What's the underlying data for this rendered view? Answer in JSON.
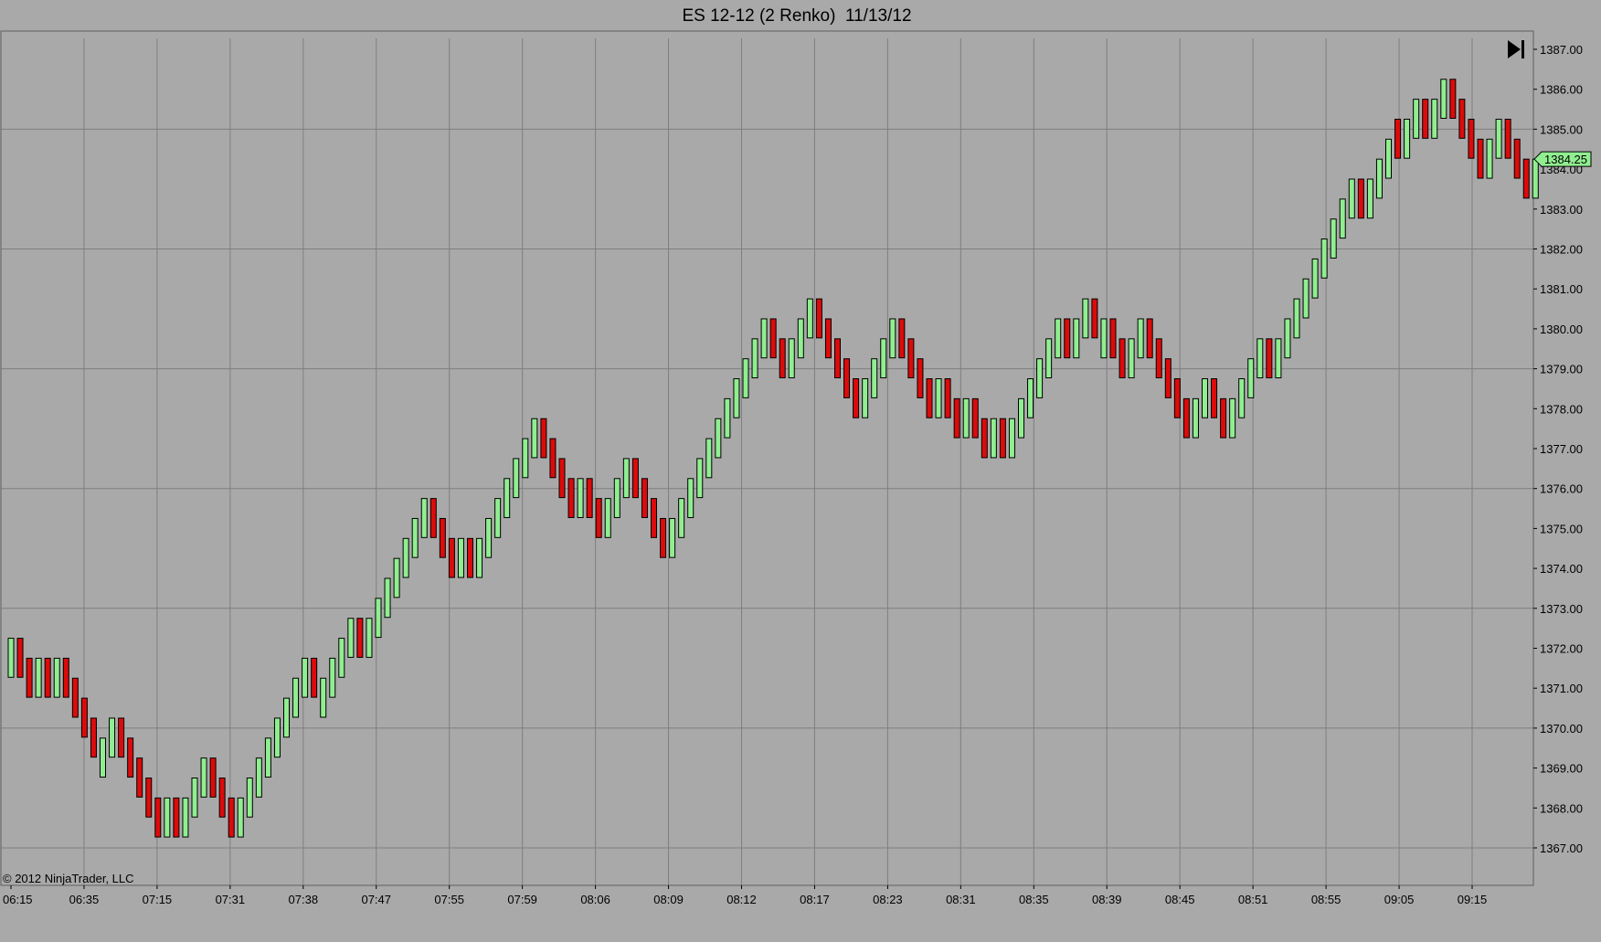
{
  "window": {
    "title": "ES 12-12 (2 Renko)  11/13/12",
    "copyright": "© 2012 NinjaTrader, LLC",
    "scroll_to_end_icon": "skip-to-end-icon"
  },
  "colors": {
    "background": "#a9a9a9",
    "grid": "#7f7f7f",
    "up_brick": "#90ee90",
    "down_brick": "#dc0b0b",
    "brick_outline": "#000000",
    "current_price_marker": "#90ee90"
  },
  "chart_data": {
    "type": "renko",
    "title": "ES 12-12 (2 Renko)  11/13/12",
    "brick_size": 2,
    "ylim": [
      1366.2,
      1387.5
    ],
    "y_ticks": [
      "1367.00",
      "1368.00",
      "1369.00",
      "1370.00",
      "1371.00",
      "1372.00",
      "1373.00",
      "1374.00",
      "1375.00",
      "1376.00",
      "1377.00",
      "1378.00",
      "1379.00",
      "1380.00",
      "1381.00",
      "1382.00",
      "1383.00",
      "1384.00",
      "1385.00",
      "1386.00",
      "1387.00"
    ],
    "x_ticks": [
      "06:15",
      "06:35",
      "07:15",
      "07:31",
      "07:38",
      "07:47",
      "07:55",
      "07:59",
      "08:06",
      "08:09",
      "08:12",
      "08:17",
      "08:23",
      "08:31",
      "08:35",
      "08:39",
      "08:45",
      "08:51",
      "08:55",
      "09:05",
      "09:15"
    ],
    "current_price": "1384.25",
    "grid": true,
    "bricks": [
      {
        "close": 1372.25,
        "dir": "up"
      },
      {
        "close": 1371.25,
        "dir": "down"
      },
      {
        "close": 1370.75,
        "dir": "down"
      },
      {
        "close": 1371.75,
        "dir": "up"
      },
      {
        "close": 1370.75,
        "dir": "down"
      },
      {
        "close": 1371.75,
        "dir": "up"
      },
      {
        "close": 1370.75,
        "dir": "down"
      },
      {
        "close": 1370.25,
        "dir": "down"
      },
      {
        "close": 1369.75,
        "dir": "down"
      },
      {
        "close": 1369.25,
        "dir": "down"
      },
      {
        "close": 1369.75,
        "dir": "up"
      },
      {
        "close": 1370.25,
        "dir": "up"
      },
      {
        "close": 1369.25,
        "dir": "down"
      },
      {
        "close": 1368.75,
        "dir": "down"
      },
      {
        "close": 1368.25,
        "dir": "down"
      },
      {
        "close": 1367.75,
        "dir": "down"
      },
      {
        "close": 1367.25,
        "dir": "down"
      },
      {
        "close": 1368.25,
        "dir": "up"
      },
      {
        "close": 1367.25,
        "dir": "down"
      },
      {
        "close": 1368.25,
        "dir": "up"
      },
      {
        "close": 1368.75,
        "dir": "up"
      },
      {
        "close": 1369.25,
        "dir": "up"
      },
      {
        "close": 1368.25,
        "dir": "down"
      },
      {
        "close": 1367.75,
        "dir": "down"
      },
      {
        "close": 1367.25,
        "dir": "down"
      },
      {
        "close": 1368.25,
        "dir": "up"
      },
      {
        "close": 1368.75,
        "dir": "up"
      },
      {
        "close": 1369.25,
        "dir": "up"
      },
      {
        "close": 1369.75,
        "dir": "up"
      },
      {
        "close": 1370.25,
        "dir": "up"
      },
      {
        "close": 1370.75,
        "dir": "up"
      },
      {
        "close": 1371.25,
        "dir": "up"
      },
      {
        "close": 1371.75,
        "dir": "up"
      },
      {
        "close": 1370.75,
        "dir": "down"
      },
      {
        "close": 1371.25,
        "dir": "up"
      },
      {
        "close": 1371.75,
        "dir": "up"
      },
      {
        "close": 1372.25,
        "dir": "up"
      },
      {
        "close": 1372.75,
        "dir": "up"
      },
      {
        "close": 1371.75,
        "dir": "down"
      },
      {
        "close": 1372.75,
        "dir": "up"
      },
      {
        "close": 1373.25,
        "dir": "up"
      },
      {
        "close": 1373.75,
        "dir": "up"
      },
      {
        "close": 1374.25,
        "dir": "up"
      },
      {
        "close": 1374.75,
        "dir": "up"
      },
      {
        "close": 1375.25,
        "dir": "up"
      },
      {
        "close": 1375.75,
        "dir": "up"
      },
      {
        "close": 1374.75,
        "dir": "down"
      },
      {
        "close": 1374.25,
        "dir": "down"
      },
      {
        "close": 1373.75,
        "dir": "down"
      },
      {
        "close": 1374.75,
        "dir": "up"
      },
      {
        "close": 1373.75,
        "dir": "down"
      },
      {
        "close": 1374.75,
        "dir": "up"
      },
      {
        "close": 1375.25,
        "dir": "up"
      },
      {
        "close": 1375.75,
        "dir": "up"
      },
      {
        "close": 1376.25,
        "dir": "up"
      },
      {
        "close": 1376.75,
        "dir": "up"
      },
      {
        "close": 1377.25,
        "dir": "up"
      },
      {
        "close": 1377.75,
        "dir": "up"
      },
      {
        "close": 1376.75,
        "dir": "down"
      },
      {
        "close": 1376.25,
        "dir": "down"
      },
      {
        "close": 1375.75,
        "dir": "down"
      },
      {
        "close": 1375.25,
        "dir": "down"
      },
      {
        "close": 1376.25,
        "dir": "up"
      },
      {
        "close": 1375.25,
        "dir": "down"
      },
      {
        "close": 1374.75,
        "dir": "down"
      },
      {
        "close": 1375.75,
        "dir": "up"
      },
      {
        "close": 1376.25,
        "dir": "up"
      },
      {
        "close": 1376.75,
        "dir": "up"
      },
      {
        "close": 1375.75,
        "dir": "down"
      },
      {
        "close": 1375.25,
        "dir": "down"
      },
      {
        "close": 1374.75,
        "dir": "down"
      },
      {
        "close": 1374.25,
        "dir": "down"
      },
      {
        "close": 1375.25,
        "dir": "up"
      },
      {
        "close": 1375.75,
        "dir": "up"
      },
      {
        "close": 1376.25,
        "dir": "up"
      },
      {
        "close": 1376.75,
        "dir": "up"
      },
      {
        "close": 1377.25,
        "dir": "up"
      },
      {
        "close": 1377.75,
        "dir": "up"
      },
      {
        "close": 1378.25,
        "dir": "up"
      },
      {
        "close": 1378.75,
        "dir": "up"
      },
      {
        "close": 1379.25,
        "dir": "up"
      },
      {
        "close": 1379.75,
        "dir": "up"
      },
      {
        "close": 1380.25,
        "dir": "up"
      },
      {
        "close": 1379.25,
        "dir": "down"
      },
      {
        "close": 1378.75,
        "dir": "down"
      },
      {
        "close": 1379.75,
        "dir": "up"
      },
      {
        "close": 1380.25,
        "dir": "up"
      },
      {
        "close": 1380.75,
        "dir": "up"
      },
      {
        "close": 1379.75,
        "dir": "down"
      },
      {
        "close": 1379.25,
        "dir": "down"
      },
      {
        "close": 1378.75,
        "dir": "down"
      },
      {
        "close": 1378.25,
        "dir": "down"
      },
      {
        "close": 1377.75,
        "dir": "down"
      },
      {
        "close": 1378.75,
        "dir": "up"
      },
      {
        "close": 1379.25,
        "dir": "up"
      },
      {
        "close": 1379.75,
        "dir": "up"
      },
      {
        "close": 1380.25,
        "dir": "up"
      },
      {
        "close": 1379.25,
        "dir": "down"
      },
      {
        "close": 1378.75,
        "dir": "down"
      },
      {
        "close": 1378.25,
        "dir": "down"
      },
      {
        "close": 1377.75,
        "dir": "down"
      },
      {
        "close": 1378.75,
        "dir": "up"
      },
      {
        "close": 1377.75,
        "dir": "down"
      },
      {
        "close": 1377.25,
        "dir": "down"
      },
      {
        "close": 1378.25,
        "dir": "up"
      },
      {
        "close": 1377.25,
        "dir": "down"
      },
      {
        "close": 1376.75,
        "dir": "down"
      },
      {
        "close": 1377.75,
        "dir": "up"
      },
      {
        "close": 1376.75,
        "dir": "down"
      },
      {
        "close": 1377.75,
        "dir": "up"
      },
      {
        "close": 1378.25,
        "dir": "up"
      },
      {
        "close": 1378.75,
        "dir": "up"
      },
      {
        "close": 1379.25,
        "dir": "up"
      },
      {
        "close": 1379.75,
        "dir": "up"
      },
      {
        "close": 1380.25,
        "dir": "up"
      },
      {
        "close": 1379.25,
        "dir": "down"
      },
      {
        "close": 1380.25,
        "dir": "up"
      },
      {
        "close": 1380.75,
        "dir": "up"
      },
      {
        "close": 1379.75,
        "dir": "down"
      },
      {
        "close": 1380.25,
        "dir": "up"
      },
      {
        "close": 1379.25,
        "dir": "down"
      },
      {
        "close": 1378.75,
        "dir": "down"
      },
      {
        "close": 1379.75,
        "dir": "up"
      },
      {
        "close": 1380.25,
        "dir": "up"
      },
      {
        "close": 1379.25,
        "dir": "down"
      },
      {
        "close": 1378.75,
        "dir": "down"
      },
      {
        "close": 1378.25,
        "dir": "down"
      },
      {
        "close": 1377.75,
        "dir": "down"
      },
      {
        "close": 1377.25,
        "dir": "down"
      },
      {
        "close": 1378.25,
        "dir": "up"
      },
      {
        "close": 1378.75,
        "dir": "up"
      },
      {
        "close": 1377.75,
        "dir": "down"
      },
      {
        "close": 1377.25,
        "dir": "down"
      },
      {
        "close": 1378.25,
        "dir": "up"
      },
      {
        "close": 1378.75,
        "dir": "up"
      },
      {
        "close": 1379.25,
        "dir": "up"
      },
      {
        "close": 1379.75,
        "dir": "up"
      },
      {
        "close": 1378.75,
        "dir": "down"
      },
      {
        "close": 1379.75,
        "dir": "up"
      },
      {
        "close": 1380.25,
        "dir": "up"
      },
      {
        "close": 1380.75,
        "dir": "up"
      },
      {
        "close": 1381.25,
        "dir": "up"
      },
      {
        "close": 1381.75,
        "dir": "up"
      },
      {
        "close": 1382.25,
        "dir": "up"
      },
      {
        "close": 1382.75,
        "dir": "up"
      },
      {
        "close": 1383.25,
        "dir": "up"
      },
      {
        "close": 1383.75,
        "dir": "up"
      },
      {
        "close": 1382.75,
        "dir": "down"
      },
      {
        "close": 1383.75,
        "dir": "up"
      },
      {
        "close": 1384.25,
        "dir": "up"
      },
      {
        "close": 1384.75,
        "dir": "up"
      },
      {
        "close": 1384.25,
        "dir": "down"
      },
      {
        "close": 1385.25,
        "dir": "up"
      },
      {
        "close": 1385.75,
        "dir": "up"
      },
      {
        "close": 1384.75,
        "dir": "down"
      },
      {
        "close": 1385.75,
        "dir": "up"
      },
      {
        "close": 1386.25,
        "dir": "up"
      },
      {
        "close": 1385.25,
        "dir": "down"
      },
      {
        "close": 1384.75,
        "dir": "down"
      },
      {
        "close": 1384.25,
        "dir": "down"
      },
      {
        "close": 1383.75,
        "dir": "down"
      },
      {
        "close": 1384.75,
        "dir": "up"
      },
      {
        "close": 1385.25,
        "dir": "up"
      },
      {
        "close": 1384.25,
        "dir": "down"
      },
      {
        "close": 1383.75,
        "dir": "down"
      },
      {
        "close": 1383.25,
        "dir": "down"
      },
      {
        "close": 1384.25,
        "dir": "up"
      }
    ]
  }
}
